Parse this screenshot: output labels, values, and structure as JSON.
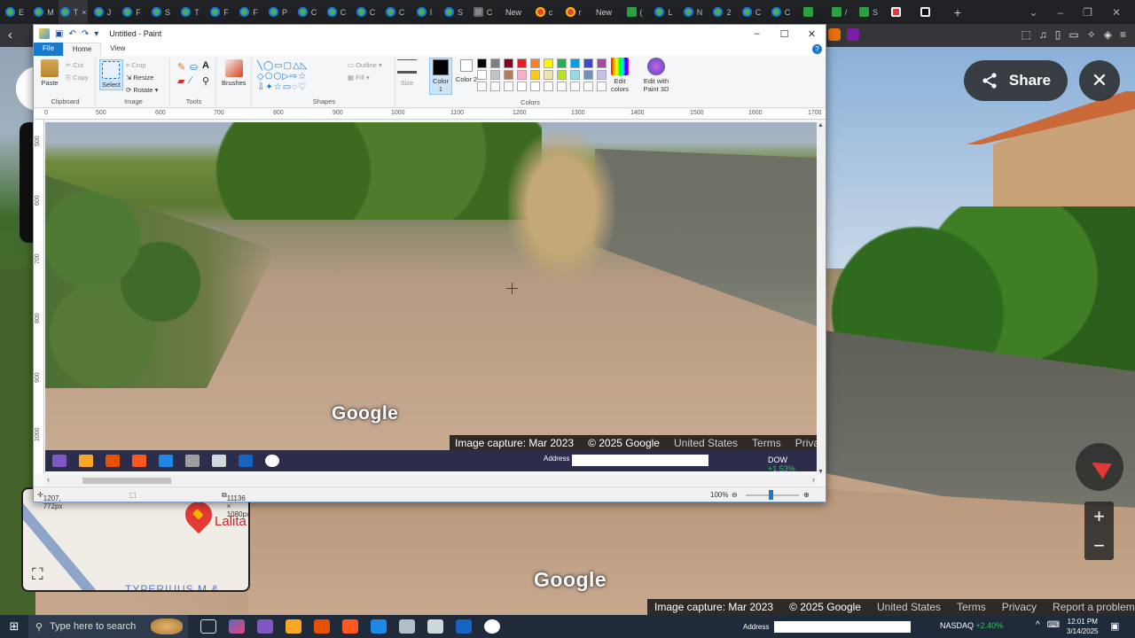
{
  "browser": {
    "tabs": [
      {
        "label": "E",
        "fav": "maps"
      },
      {
        "label": "M",
        "fav": "maps"
      },
      {
        "label": "T",
        "fav": "maps",
        "active": true
      },
      {
        "label": "J",
        "fav": "maps"
      },
      {
        "label": "F",
        "fav": "maps"
      },
      {
        "label": "S",
        "fav": "maps"
      },
      {
        "label": "T",
        "fav": "maps"
      },
      {
        "label": "F",
        "fav": "maps"
      },
      {
        "label": "F",
        "fav": "maps"
      },
      {
        "label": "P",
        "fav": "maps"
      },
      {
        "label": "C",
        "fav": "maps"
      },
      {
        "label": "C",
        "fav": "maps"
      },
      {
        "label": "C",
        "fav": "maps"
      },
      {
        "label": "C",
        "fav": "maps"
      },
      {
        "label": "I",
        "fav": "maps"
      },
      {
        "label": "S",
        "fav": "maps"
      },
      {
        "label": "C",
        "fav": "n"
      }
    ],
    "new_tab_1": "New",
    "tabs2": [
      {
        "label": "c",
        "fav": "g"
      },
      {
        "label": "r",
        "fav": "g"
      }
    ],
    "new_tab_2": "New",
    "tabs3": [
      {
        "label": "(",
        "fav": "v"
      },
      {
        "label": "L",
        "fav": "maps"
      },
      {
        "label": "N",
        "fav": "maps"
      },
      {
        "label": "2",
        "fav": "maps"
      },
      {
        "label": "C",
        "fav": "maps"
      },
      {
        "label": "C",
        "fav": "maps"
      },
      {
        "label": "",
        "fav": "v"
      },
      {
        "label": "/",
        "fav": "v"
      },
      {
        "label": "S",
        "fav": "v"
      },
      {
        "label": "",
        "fav": "r"
      },
      {
        "label": "",
        "fav": "x"
      }
    ],
    "add_tab": "+",
    "tab_close": "×"
  },
  "streetview": {
    "share_label": "Share",
    "close_glyph": "✕",
    "zoom_in": "+",
    "zoom_out": "−",
    "google": "Google",
    "footer": {
      "capture": "Image capture: Mar 2023",
      "copyright": "© 2025 Google",
      "country": "United States",
      "terms": "Terms",
      "privacy": "Privacy",
      "report": "Report a problem"
    },
    "minimap": {
      "place": "Lalita",
      "sub": "TYPERIUUS M &"
    }
  },
  "paint": {
    "title": "Untitled - Paint",
    "tabs": {
      "file": "File",
      "home": "Home",
      "view": "View"
    },
    "help": "?",
    "clipboard": {
      "paste": "Paste",
      "cut": "Cut",
      "copy": "Copy",
      "label": "Clipboard"
    },
    "image": {
      "select": "Select",
      "crop": "Crop",
      "resize": "Resize",
      "rotate": "Rotate",
      "label": "Image"
    },
    "tools": {
      "label": "Tools"
    },
    "brushes": {
      "label": "Brushes"
    },
    "shapes": {
      "outline": "Outline",
      "fill": "Fill",
      "label": "Shapes"
    },
    "size": {
      "label": "Size"
    },
    "color1": {
      "label": "Color 1"
    },
    "color2": {
      "label": "Color 2"
    },
    "colors": {
      "label": "Colors",
      "edit": "Edit colors",
      "paint3d": "Edit with Paint 3D"
    },
    "palette": [
      "#000000",
      "#7f7f7f",
      "#880015",
      "#ed1c24",
      "#ff7f27",
      "#fff200",
      "#22b14c",
      "#00a2e8",
      "#3f48cc",
      "#a349a4",
      "#ffffff",
      "#c3c3c3",
      "#b97a57",
      "#ffaec9",
      "#ffc90e",
      "#efe4b0",
      "#b5e61d",
      "#99d9ea",
      "#7092be",
      "#c8bfe7",
      "#ffffff",
      "#ffffff",
      "#ffffff",
      "#ffffff",
      "#ffffff",
      "#ffffff",
      "#ffffff",
      "#ffffff",
      "#ffffff",
      "#ffffff"
    ],
    "ruler_h": [
      "0",
      "500",
      "600",
      "700",
      "800",
      "900",
      "1000",
      "1100",
      "1200",
      "1300",
      "1400",
      "1500",
      "1600",
      "1700"
    ],
    "ruler_v": [
      "500",
      "600",
      "700",
      "800",
      "900",
      "1000"
    ],
    "canvas": {
      "google": "Google",
      "footer": {
        "capture": "Image capture: Mar 2023",
        "copyright": "© 2025 Google",
        "country": "United States",
        "terms": "Terms",
        "privacy": "Privac"
      },
      "taskbar": {
        "address": "Address",
        "dow": "DOW",
        "dow_change": "+1.53%"
      }
    },
    "status": {
      "cursor": "1207, 772px",
      "size": "11136 × 1080px",
      "zoom": "100%"
    }
  },
  "taskbar": {
    "search_placeholder": "Type here to search",
    "address": "Address",
    "nasdaq": "NASDAQ",
    "nasdaq_change": "+2.40%",
    "time": "12:01 PM",
    "date": "3/14/2025"
  }
}
